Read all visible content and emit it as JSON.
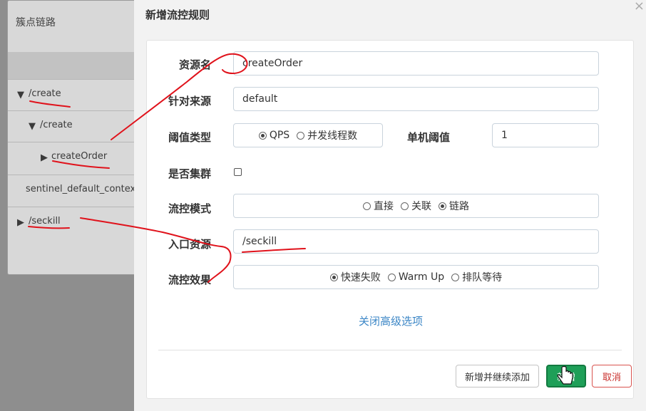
{
  "tree": {
    "title": "簇点链路",
    "items": [
      {
        "label": "/create"
      },
      {
        "label": "/create"
      },
      {
        "label": "createOrder"
      },
      {
        "label": "sentinel_default_context"
      },
      {
        "label": "/seckill"
      }
    ]
  },
  "modal": {
    "title": "新增流控规则",
    "close": "×",
    "fields": {
      "resource": {
        "label": "资源名",
        "value": "createOrder"
      },
      "source": {
        "label": "针对来源",
        "value": "default"
      },
      "threshold_type": {
        "label": "阈值类型",
        "options": [
          "QPS",
          "并发线程数"
        ],
        "selected": "QPS"
      },
      "single_threshold": {
        "label": "单机阈值",
        "value": "1"
      },
      "cluster": {
        "label": "是否集群",
        "checked": false
      },
      "mode": {
        "label": "流控模式",
        "options": [
          "直接",
          "关联",
          "链路"
        ],
        "selected": "链路"
      },
      "entry_resource": {
        "label": "入口资源",
        "value": "/seckill"
      },
      "effect": {
        "label": "流控效果",
        "options": [
          "快速失败",
          "Warm Up",
          "排队等待"
        ],
        "selected": "快速失败"
      }
    },
    "advanced_link": "关闭高级选项",
    "buttons": {
      "add_continue": "新增并继续添加",
      "add": "新增",
      "cancel": "取消"
    }
  },
  "colors": {
    "primary": "#1e9f58",
    "link": "#3b86c6",
    "cancel": "#c9302c",
    "annotation": "#e0121b"
  }
}
